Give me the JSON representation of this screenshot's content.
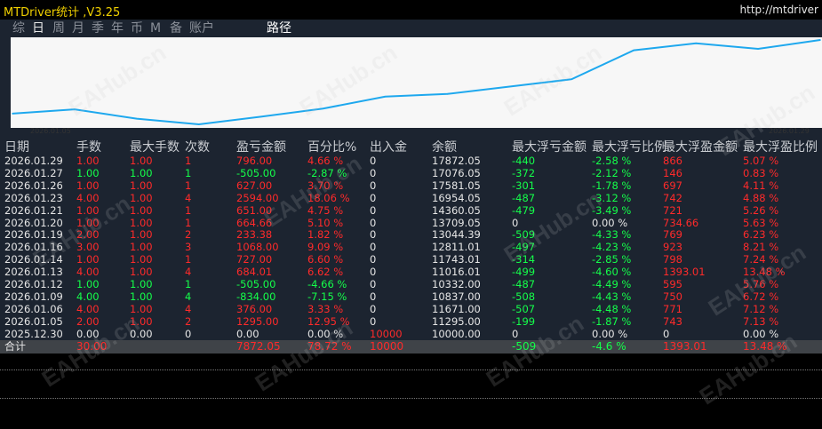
{
  "window": {
    "title": "MTDriver统计 ,V3.25",
    "url": "http://mtdriver"
  },
  "tabs": [
    {
      "label": "综"
    },
    {
      "label": "日"
    },
    {
      "label": "周"
    },
    {
      "label": "月"
    },
    {
      "label": "季"
    },
    {
      "label": "年"
    },
    {
      "label": "币"
    },
    {
      "label": "M"
    },
    {
      "label": "备"
    },
    {
      "label": "账户"
    },
    {
      "label": "路径"
    }
  ],
  "active_tab": "日",
  "chart_data": {
    "type": "line",
    "x_start_label": "2026.01.05",
    "x_end_label": "2026.01.29",
    "x": [
      "2026.01.05",
      "2026.01.06",
      "2026.01.09",
      "2026.01.12",
      "2026.01.13",
      "2026.01.14",
      "2026.01.16",
      "2026.01.19",
      "2026.01.20",
      "2026.01.21",
      "2026.01.23",
      "2026.01.26",
      "2026.01.27",
      "2026.01.29"
    ],
    "values": [
      11295.0,
      11671.0,
      10837.0,
      10332.0,
      11016.01,
      11743.01,
      12811.01,
      13044.39,
      13709.05,
      14360.05,
      16954.05,
      17581.05,
      17076.05,
      17872.05
    ],
    "color": "#1ea8ee"
  },
  "table": {
    "headers": [
      "日期",
      "手数",
      "最大手数",
      "次数",
      "盈亏金额",
      "百分比%",
      "出入金",
      "余额",
      "最大浮亏金额",
      "最大浮亏比例",
      "最大浮盈金额",
      "最大浮盈比例"
    ],
    "rows": [
      {
        "date": "2026.01.29",
        "lots": "1.00",
        "max_lots": "1.00",
        "count": "1",
        "pnl": "796.00",
        "pct": "4.66 %",
        "io": "0",
        "balance": "17872.05",
        "fl_amt": "-440",
        "fl_pct": "-2.58 %",
        "fp_amt": "866",
        "fp_pct": "5.07 %",
        "sign": "pos"
      },
      {
        "date": "2026.01.27",
        "lots": "1.00",
        "max_lots": "1.00",
        "count": "1",
        "pnl": "-505.00",
        "pct": "-2.87 %",
        "io": "0",
        "balance": "17076.05",
        "fl_amt": "-372",
        "fl_pct": "-2.12 %",
        "fp_amt": "146",
        "fp_pct": "0.83 %",
        "sign": "neg"
      },
      {
        "date": "2026.01.26",
        "lots": "1.00",
        "max_lots": "1.00",
        "count": "1",
        "pnl": "627.00",
        "pct": "3.70 %",
        "io": "0",
        "balance": "17581.05",
        "fl_amt": "-301",
        "fl_pct": "-1.78 %",
        "fp_amt": "697",
        "fp_pct": "4.11 %",
        "sign": "pos"
      },
      {
        "date": "2026.01.23",
        "lots": "4.00",
        "max_lots": "1.00",
        "count": "4",
        "pnl": "2594.00",
        "pct": "18.06 %",
        "io": "0",
        "balance": "16954.05",
        "fl_amt": "-487",
        "fl_pct": "-3.12 %",
        "fp_amt": "742",
        "fp_pct": "4.88 %",
        "sign": "pos"
      },
      {
        "date": "2026.01.21",
        "lots": "1.00",
        "max_lots": "1.00",
        "count": "1",
        "pnl": "651.00",
        "pct": "4.75 %",
        "io": "0",
        "balance": "14360.05",
        "fl_amt": "-479",
        "fl_pct": "-3.49 %",
        "fp_amt": "721",
        "fp_pct": "5.26 %",
        "sign": "pos"
      },
      {
        "date": "2026.01.20",
        "lots": "1.00",
        "max_lots": "1.00",
        "count": "1",
        "pnl": "664.66",
        "pct": "5.10 %",
        "io": "0",
        "balance": "13709.05",
        "fl_amt": "0",
        "fl_pct": "0.00 %",
        "fp_amt": "734.66",
        "fp_pct": "5.63 %",
        "sign": "pos",
        "fl_zero": true
      },
      {
        "date": "2026.01.19",
        "lots": "2.00",
        "max_lots": "1.00",
        "count": "2",
        "pnl": "233.38",
        "pct": "1.82 %",
        "io": "0",
        "balance": "13044.39",
        "fl_amt": "-509",
        "fl_pct": "-4.33 %",
        "fp_amt": "769",
        "fp_pct": "6.23 %",
        "sign": "pos"
      },
      {
        "date": "2026.01.16",
        "lots": "3.00",
        "max_lots": "1.00",
        "count": "3",
        "pnl": "1068.00",
        "pct": "9.09 %",
        "io": "0",
        "balance": "12811.01",
        "fl_amt": "-497",
        "fl_pct": "-4.23 %",
        "fp_amt": "923",
        "fp_pct": "8.21 %",
        "sign": "pos"
      },
      {
        "date": "2026.01.14",
        "lots": "1.00",
        "max_lots": "1.00",
        "count": "1",
        "pnl": "727.00",
        "pct": "6.60 %",
        "io": "0",
        "balance": "11743.01",
        "fl_amt": "-314",
        "fl_pct": "-2.85 %",
        "fp_amt": "798",
        "fp_pct": "7.24 %",
        "sign": "pos"
      },
      {
        "date": "2026.01.13",
        "lots": "4.00",
        "max_lots": "1.00",
        "count": "4",
        "pnl": "684.01",
        "pct": "6.62 %",
        "io": "0",
        "balance": "11016.01",
        "fl_amt": "-499",
        "fl_pct": "-4.60 %",
        "fp_amt": "1393.01",
        "fp_pct": "13.48 %",
        "sign": "pos"
      },
      {
        "date": "2026.01.12",
        "lots": "1.00",
        "max_lots": "1.00",
        "count": "1",
        "pnl": "-505.00",
        "pct": "-4.66 %",
        "io": "0",
        "balance": "10332.00",
        "fl_amt": "-487",
        "fl_pct": "-4.49 %",
        "fp_amt": "595",
        "fp_pct": "5.76 %",
        "sign": "neg"
      },
      {
        "date": "2026.01.09",
        "lots": "4.00",
        "max_lots": "1.00",
        "count": "4",
        "pnl": "-834.00",
        "pct": "-7.15 %",
        "io": "0",
        "balance": "10837.00",
        "fl_amt": "-508",
        "fl_pct": "-4.43 %",
        "fp_amt": "750",
        "fp_pct": "6.72 %",
        "sign": "neg"
      },
      {
        "date": "2026.01.06",
        "lots": "4.00",
        "max_lots": "1.00",
        "count": "4",
        "pnl": "376.00",
        "pct": "3.33 %",
        "io": "0",
        "balance": "11671.00",
        "fl_amt": "-507",
        "fl_pct": "-4.48 %",
        "fp_amt": "771",
        "fp_pct": "7.12 %",
        "sign": "pos"
      },
      {
        "date": "2026.01.05",
        "lots": "2.00",
        "max_lots": "1.00",
        "count": "2",
        "pnl": "1295.00",
        "pct": "12.95 %",
        "io": "0",
        "balance": "11295.00",
        "fl_amt": "-199",
        "fl_pct": "-1.87 %",
        "fp_amt": "743",
        "fp_pct": "7.13 %",
        "sign": "pos"
      },
      {
        "date": "2025.12.30",
        "lots": "0.00",
        "max_lots": "0.00",
        "count": "0",
        "pnl": "0.00",
        "pct": "0.00 %",
        "io": "10000",
        "balance": "10000.00",
        "fl_amt": "0",
        "fl_pct": "0.00 %",
        "fp_amt": "0",
        "fp_pct": "0.00 %",
        "sign": "zero",
        "fl_zero": true
      }
    ],
    "total": {
      "label": "合计",
      "lots": "30.00",
      "pnl": "7872.05",
      "pct": "78.72 %",
      "io": "10000",
      "fl_amt": "-509",
      "fl_pct": "-4.6 %",
      "fp_amt": "1393.01",
      "fp_pct": "13.48 %"
    }
  },
  "watermark": "EAHub.cn",
  "colors": {
    "positive": "#ff2a2a",
    "negative": "#14ff4a",
    "panel": "#1c2430",
    "title": "#f0d000"
  }
}
